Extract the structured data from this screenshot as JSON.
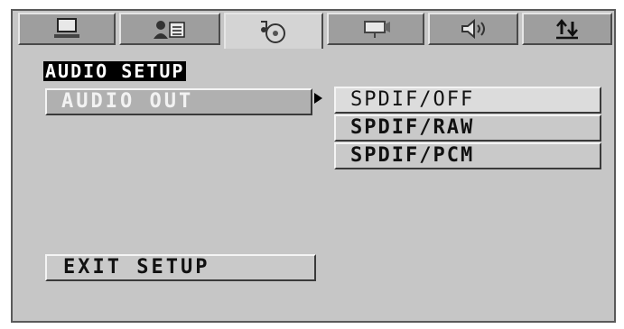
{
  "tabs": [
    {
      "icon": "monitor-icon",
      "active": false
    },
    {
      "icon": "language-icon",
      "active": false
    },
    {
      "icon": "disc-audio-icon",
      "active": true
    },
    {
      "icon": "video-icon",
      "active": false
    },
    {
      "icon": "speaker-icon",
      "active": false
    },
    {
      "icon": "sort-arrows-icon",
      "active": false
    }
  ],
  "menu": {
    "title": "AUDIO SETUP",
    "audio_out_label": "AUDIO OUT",
    "options": [
      "SPDIF/OFF",
      "SPDIF/RAW",
      "SPDIF/PCM"
    ],
    "selected_option": "SPDIF/OFF",
    "exit_label": "EXIT SETUP"
  },
  "colors": {
    "background": "#c6c6c6",
    "title_bg": "#000000",
    "title_fg": "#ffffff"
  }
}
